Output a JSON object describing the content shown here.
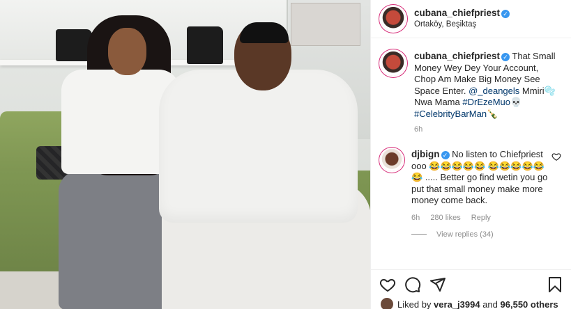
{
  "post": {
    "author": "cubana_chiefpriest",
    "location": "Ortaköy, Beşiktaş",
    "caption": {
      "author": "cubana_chiefpriest",
      "text": "That Small Money Wey Dey Your Account, Chop Am Make Big Money See Space Enter.",
      "mention": "@_deangels",
      "text2": "Mmiri",
      "emoji1": "🫧",
      "text3": "Nwa Mama",
      "hashtag1": "#DrEzeMuo",
      "emoji2": "💀",
      "hashtag2": "#CelebrityBarMan",
      "emoji3": "🍾",
      "time": "6h"
    },
    "comment": {
      "author": "djbign",
      "text_a": "No listen to Chiefpriest ooo",
      "laughs_a": "😂😂😂😂😂",
      "laughs_b": "😂😂😂😂😂😂",
      "text_b": "..... Better go find wetin you go put that small money make more money come back.",
      "time": "6h",
      "likes": "280 likes",
      "reply": "Reply",
      "view_replies": "View replies (34)"
    },
    "likes_line": {
      "prefix": "Liked by",
      "user": "vera_j3994",
      "middle": "and",
      "count": "96,550 others"
    }
  },
  "icons": {
    "heart": "heart-icon",
    "comment": "comment-icon",
    "share": "share-icon",
    "save": "bookmark-icon",
    "verified": "verified-badge-icon"
  },
  "colors": {
    "verified": "#3897f0",
    "link": "#00376b",
    "muted": "#8e8e8e"
  }
}
